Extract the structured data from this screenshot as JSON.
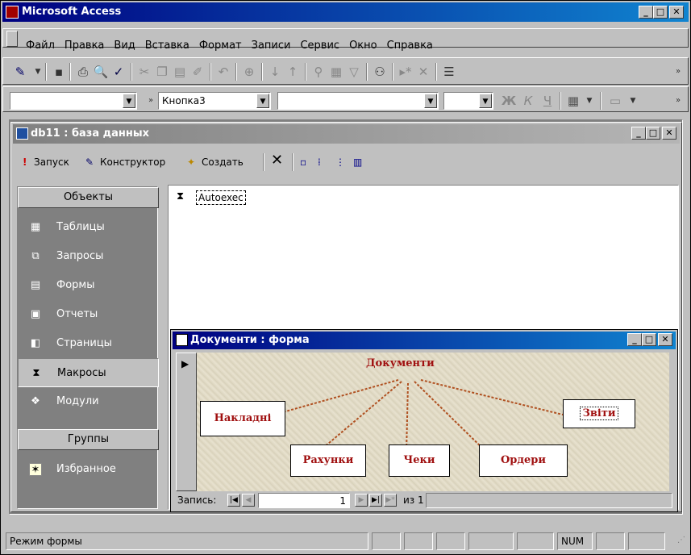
{
  "app": {
    "title": "Microsoft Access"
  },
  "menu": [
    "Файл",
    "Правка",
    "Вид",
    "Вставка",
    "Формат",
    "Записи",
    "Сервис",
    "Окно",
    "Справка"
  ],
  "toolbar2": {
    "object_combo": "",
    "control_combo": "Кнопка3",
    "font_combo": "",
    "size_combo": "",
    "bold": "Ж",
    "italic": "К",
    "underline": "Ч"
  },
  "db_window": {
    "title": "db11 : база данных",
    "toolbar": {
      "run": "Запуск",
      "design": "Конструктор",
      "create": "Создать"
    },
    "objects_header": "Объекты",
    "objects": [
      "Таблицы",
      "Запросы",
      "Формы",
      "Отчеты",
      "Страницы",
      "Макросы",
      "Модули"
    ],
    "groups_header": "Группы",
    "groups": [
      "Избранное"
    ],
    "list_items": [
      "Autoexec"
    ]
  },
  "form_window": {
    "title": "Документи : форма",
    "root_label": "Документи",
    "boxes": [
      "Накладні",
      "Рахунки",
      "Чеки",
      "Ордери",
      "Звіти"
    ],
    "nav": {
      "record_label": "Запись:",
      "record_value": "1",
      "of_label": "из 1"
    }
  },
  "status": {
    "mode": "Режим формы",
    "num": "NUM"
  }
}
